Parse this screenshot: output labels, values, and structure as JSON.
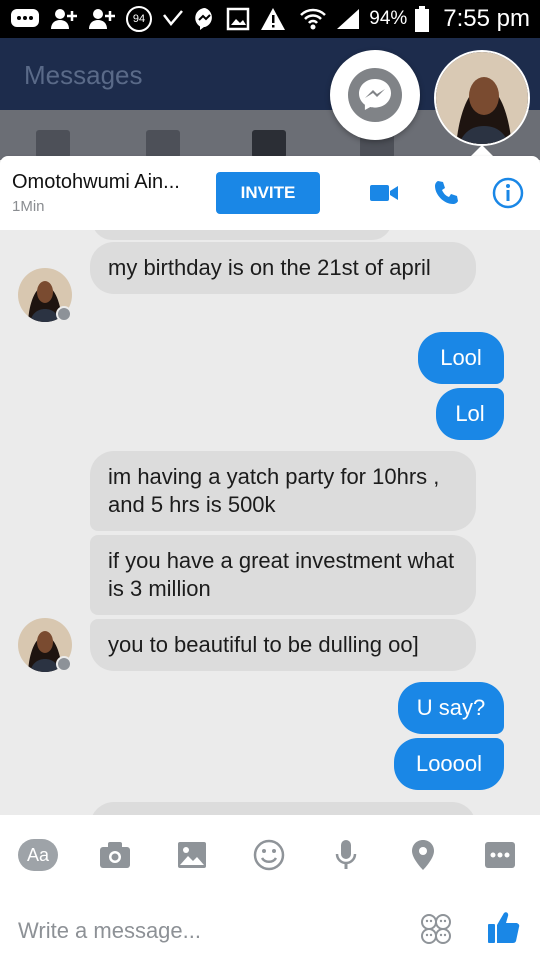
{
  "status_bar": {
    "badge": "94",
    "battery": "94%",
    "time": "7:55 pm"
  },
  "background_app": {
    "title": "Messages"
  },
  "conversation": {
    "contact_name": "Omotohwumi Ain...",
    "contact_status": "1Min",
    "invite_label": "INVITE",
    "icons": [
      "video-camera-icon",
      "phone-icon",
      "info-icon"
    ]
  },
  "messages": [
    {
      "from": "them",
      "text": "my birthday is on the 21st of april"
    },
    {
      "from": "me",
      "text": "Lool"
    },
    {
      "from": "me",
      "text": "Lol"
    },
    {
      "from": "them",
      "text": "im having a yatch party for 10hrs , and 5 hrs is 500k"
    },
    {
      "from": "them",
      "text": "if you have a great investment what is 3 million"
    },
    {
      "from": "them",
      "text": "you to beautiful to be dulling oo]"
    },
    {
      "from": "me",
      "text": "U say?"
    },
    {
      "from": "me",
      "text": "Looool"
    }
  ],
  "composer": {
    "text_button": "Aa",
    "tools": [
      "camera-icon",
      "image-icon",
      "emoji-icon",
      "microphone-icon",
      "location-icon",
      "more-icon"
    ],
    "placeholder": "Write a message...",
    "send_icon": "thumbs-up-icon"
  },
  "colors": {
    "accent": "#1a87e6",
    "incoming_bubble": "#dcdcdc",
    "background": "#ebebeb"
  }
}
